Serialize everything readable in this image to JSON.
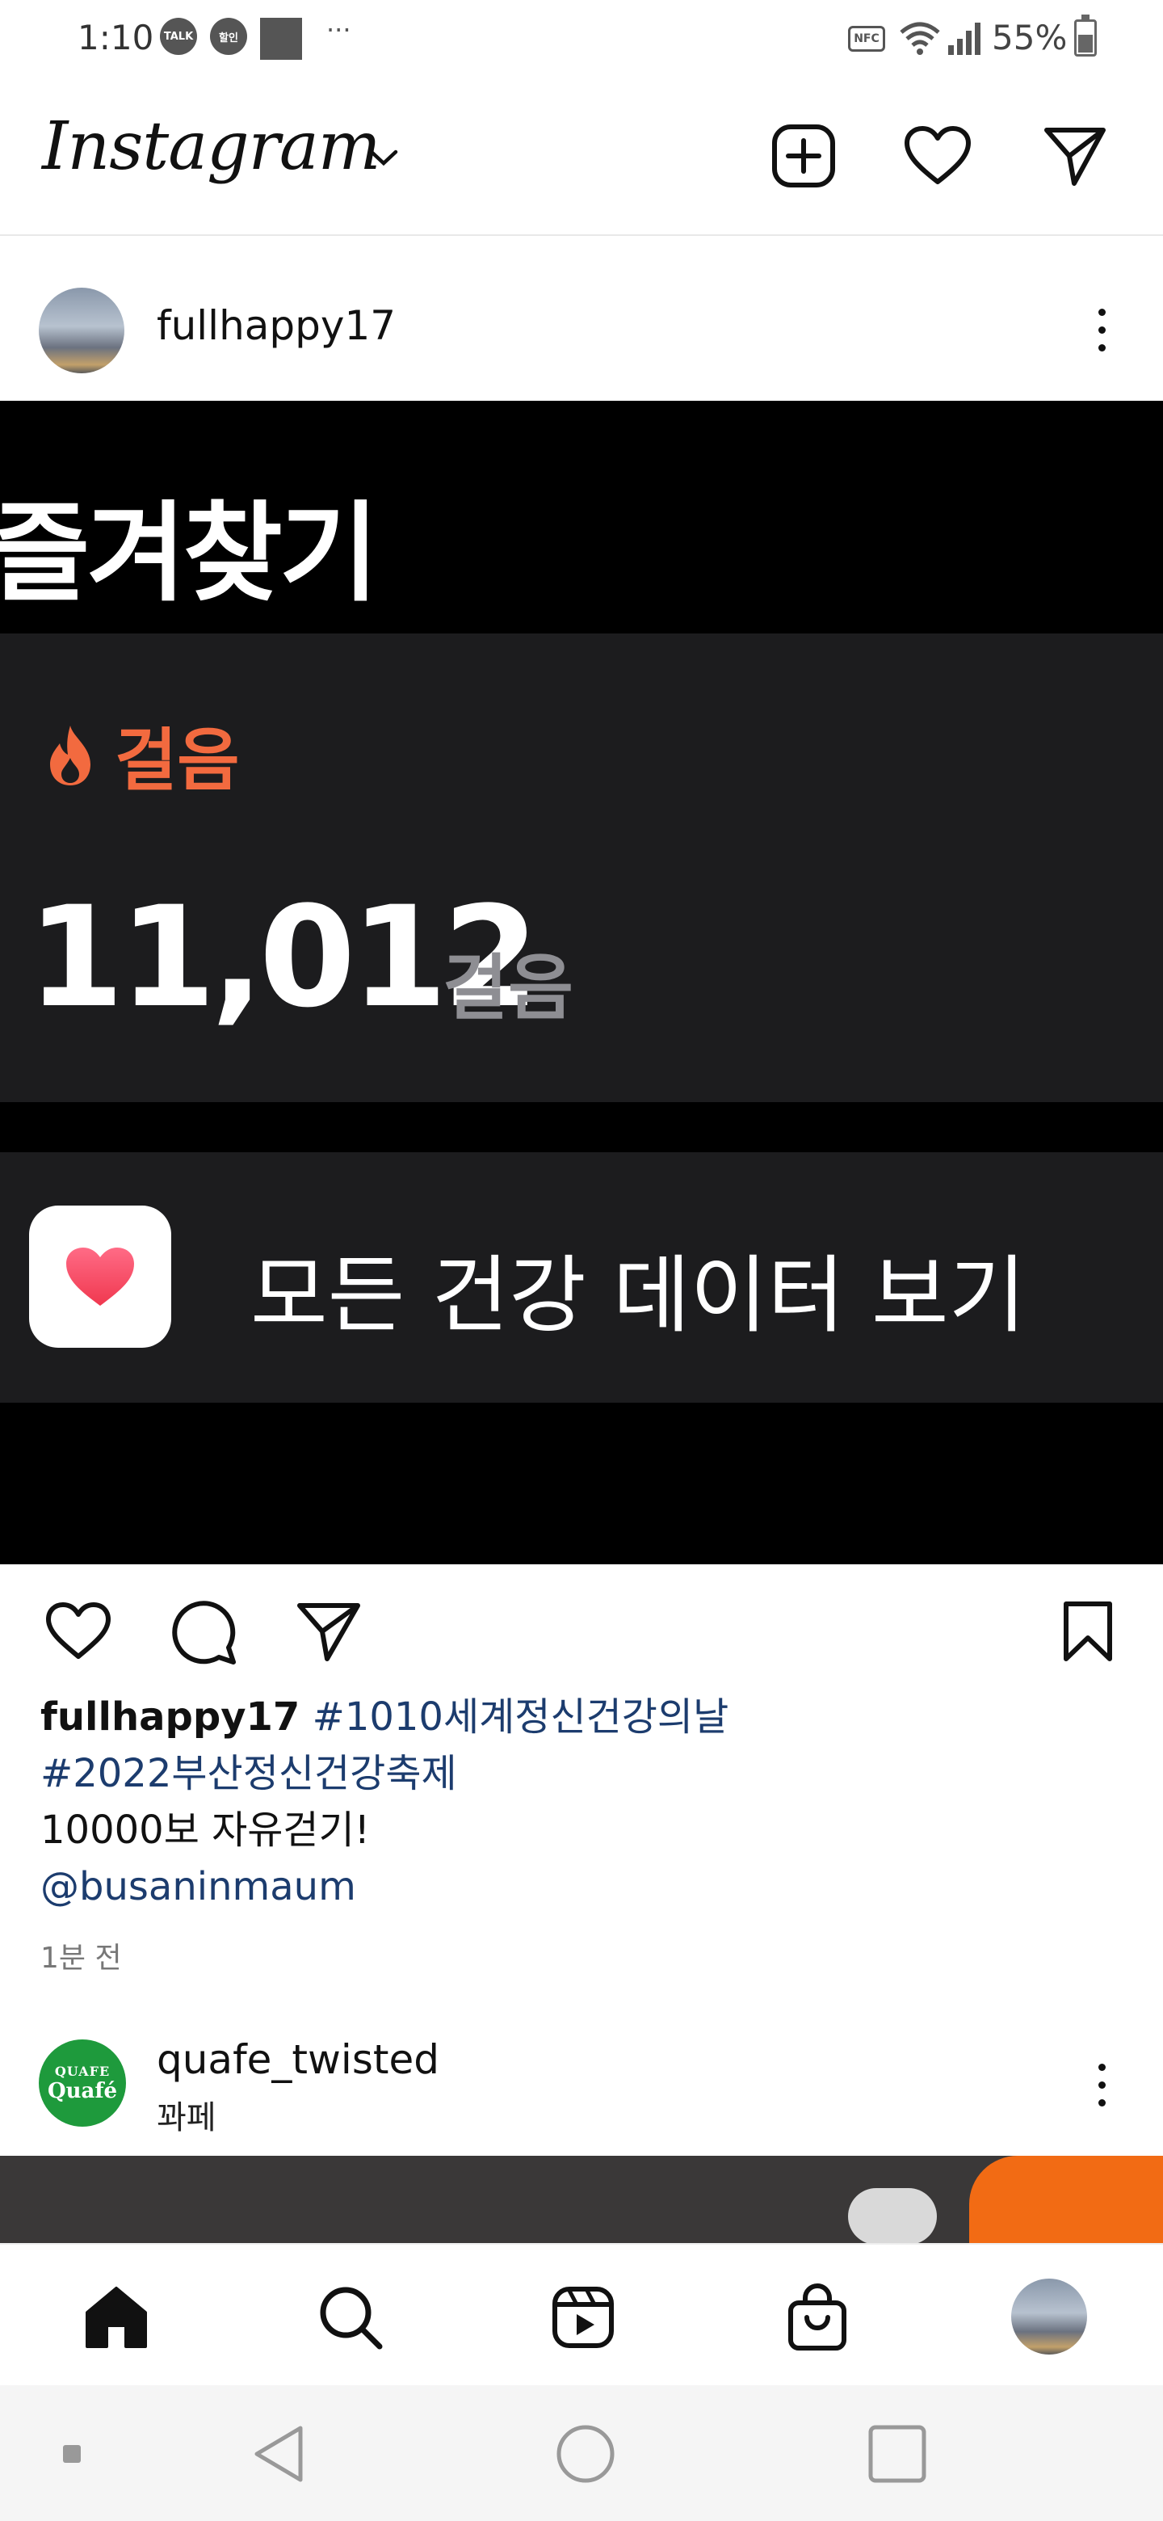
{
  "status_bar": {
    "time": "1:10",
    "notif_talk": "TALK",
    "notif_sale": "할인",
    "more": "···",
    "nfc": "NFC",
    "battery_percent": "55%"
  },
  "app_bar": {
    "logo": "Instagram"
  },
  "post": {
    "username": "fullhappy17",
    "media": {
      "title": "즐겨찾기",
      "steps_label": "걸음",
      "steps_value": "11,012",
      "steps_unit": "걸음",
      "health_link": "모든 건강 데이터 보기"
    },
    "caption": {
      "username": "fullhappy17",
      "hashtag1": "#1010세계정신건강의날",
      "hashtag2": "#2022부산정신건강축제",
      "text": "10000보 자유걷기!",
      "mention": "@busaninmaum"
    },
    "time_ago": "1분 전"
  },
  "next_post": {
    "username": "quafe_twisted",
    "subtitle": "꽈페",
    "logo_top": "QUAFE",
    "logo_text": "Quafé"
  },
  "colors": {
    "accent_orange": "#f26a3f",
    "link_blue": "#1c3c6e",
    "card_bg": "#1c1c1e",
    "quafe_green": "#1e9a3c"
  },
  "icons": {
    "header": [
      "add-post-icon",
      "heart-icon",
      "direct-message-icon"
    ],
    "actions": [
      "like-icon",
      "comment-icon",
      "share-icon",
      "save-icon"
    ],
    "bottom_nav": [
      "home-icon",
      "search-icon",
      "reels-icon",
      "shop-icon",
      "profile-avatar"
    ],
    "system_nav": [
      "recent-dot-icon",
      "back-icon",
      "home-circle-icon",
      "overview-icon"
    ]
  }
}
